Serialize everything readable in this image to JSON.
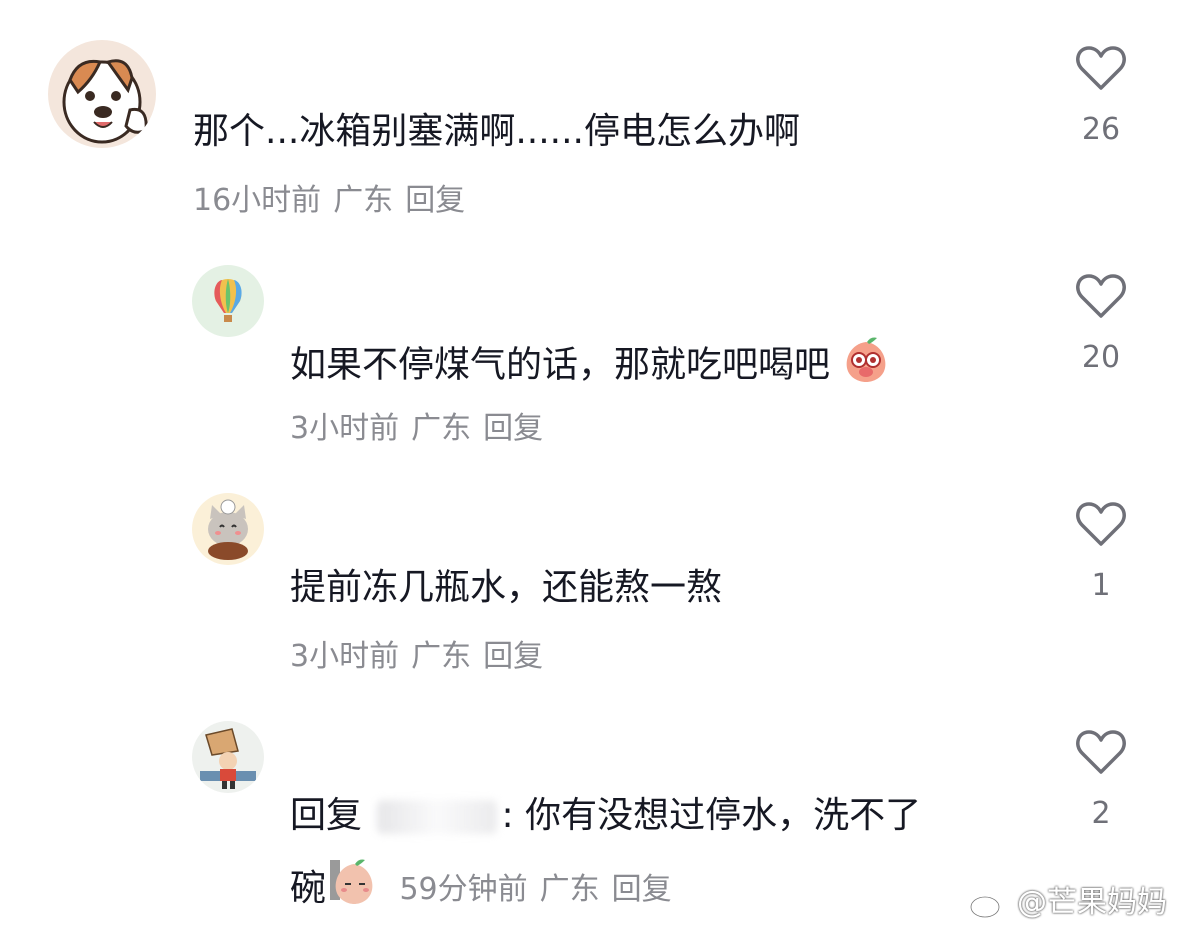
{
  "comments": [
    {
      "text": "那个...冰箱别塞满啊......停电怎么办啊",
      "time": "16小时前",
      "location": "广东",
      "reply": "回复",
      "likes": "26",
      "avatar_icon": "dog-avatar-icon"
    },
    {
      "text": "如果不停煤气的话，那就吃吧喝吧",
      "time": "3小时前",
      "location": "广东",
      "reply": "回复",
      "likes": "20",
      "avatar_icon": "hot-air-balloon-avatar-icon"
    },
    {
      "text": "提前冻几瓶水，还能熬一熬",
      "time": "3小时前",
      "location": "广东",
      "reply": "回复",
      "likes": "1",
      "avatar_icon": "cat-avatar-icon"
    },
    {
      "reply_prefix": "回复",
      "reply_target_suffix": ":",
      "text_line1": "你有没想过停水，洗不了",
      "text_line2": "碗",
      "time": "59分钟前",
      "location": "广东",
      "reply": "回复",
      "likes": "2",
      "avatar_icon": "cartoon-boy-avatar-icon"
    }
  ],
  "watermark": "@芒果妈妈",
  "colors": {
    "text": "#161823",
    "meta": "#8a8b91",
    "like_count": "#6f7078"
  }
}
